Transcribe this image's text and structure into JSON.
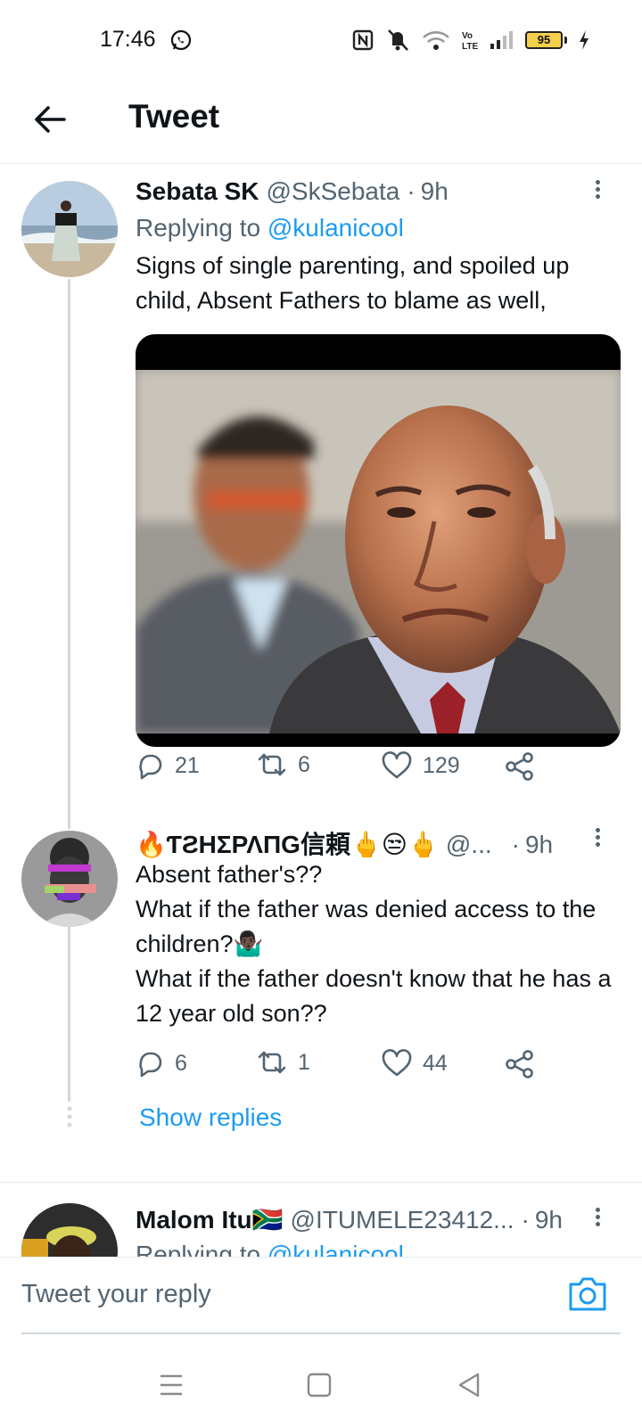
{
  "status_bar": {
    "time": "17:46",
    "battery_level": "95"
  },
  "header": {
    "title": "Tweet"
  },
  "tweets": [
    {
      "name": "Sebata SK",
      "handle": "@SkSebata",
      "time": "9h",
      "replying_prefix": "Replying to",
      "replying_to": "@kulanicool",
      "text": "Signs of single parenting, and spoiled up child, Absent Fathers to blame as well,",
      "replies": "21",
      "retweets": "6",
      "likes": "129"
    },
    {
      "name": "🔥ƬƧΗΣΡΛΠG信頼🖕😒🖕",
      "handle": "@...",
      "time": "9h",
      "text": "Absent father's??\nWhat if the father was denied access to the children?🤷🏿‍♂️\nWhat if the father doesn't know that he has a 12 year old son??",
      "replies": "6",
      "retweets": "1",
      "likes": "44",
      "show_replies": "Show replies"
    },
    {
      "name": "Malom Itu🇿🇦",
      "handle": "@ITUMELE23412...",
      "time": "9h",
      "replying_prefix": "Replying to",
      "replying_to": "@kulanicool"
    }
  ],
  "composer": {
    "placeholder": "Tweet your reply"
  },
  "colors": {
    "accent": "#1d9bf0",
    "secondary_text": "#536471",
    "primary_text": "#0f1419"
  },
  "icons": [
    "back-arrow-icon",
    "reply-icon",
    "retweet-icon",
    "like-icon",
    "share-icon",
    "more-icon",
    "camera-icon",
    "menu-icon",
    "home-icon",
    "back-nav-icon"
  ]
}
